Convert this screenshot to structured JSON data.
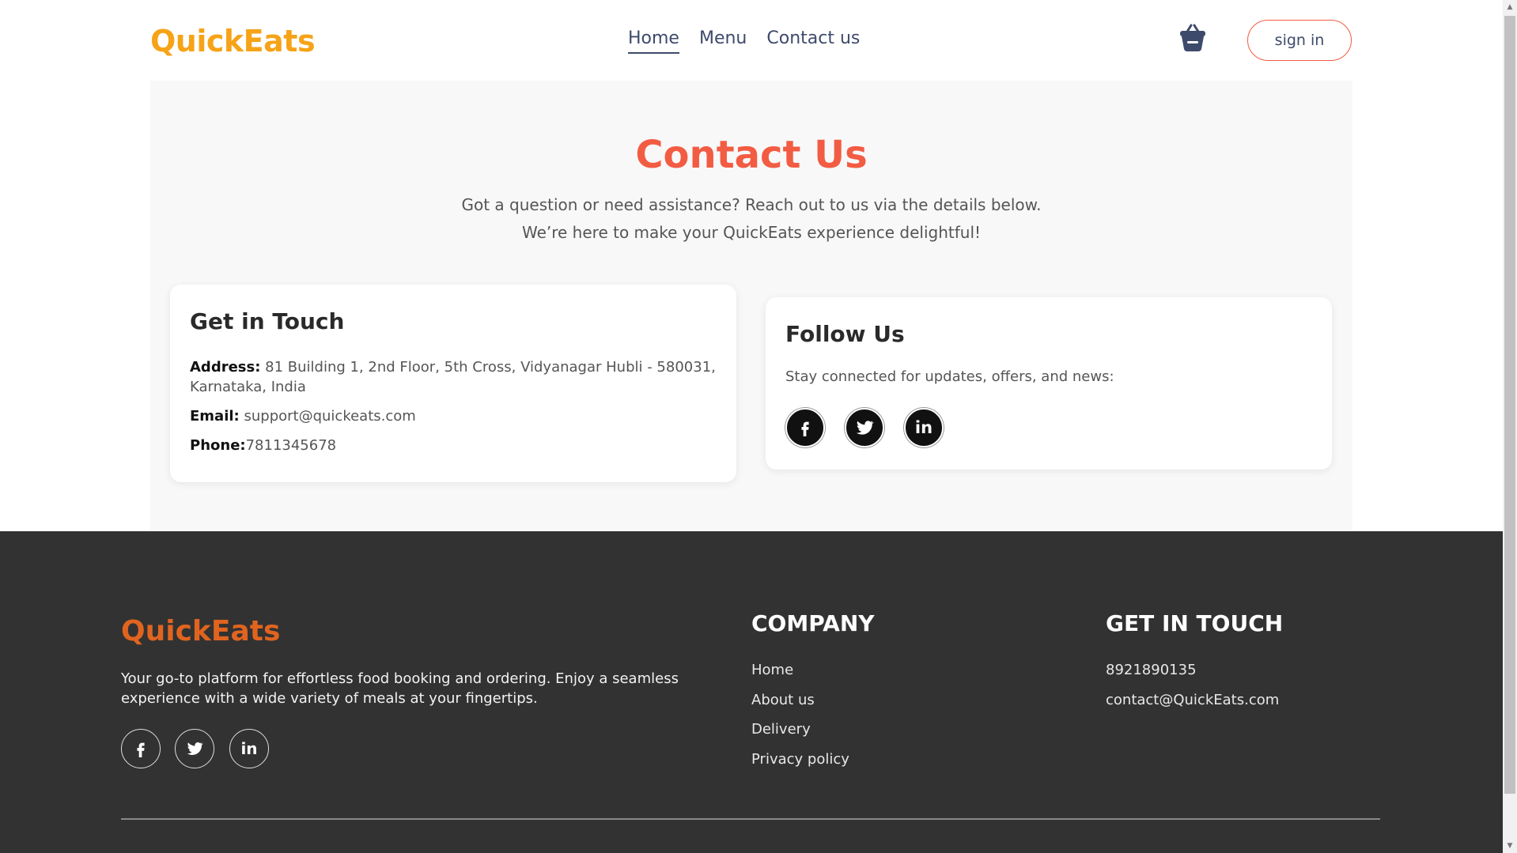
{
  "nav": {
    "logo": "QuickEats",
    "links": [
      {
        "label": "Home",
        "active": true
      },
      {
        "label": "Menu",
        "active": false
      },
      {
        "label": "Contact us",
        "active": false
      }
    ],
    "cart_icon": "basket-icon",
    "signin_label": "sign in"
  },
  "contact": {
    "title": "Contact Us",
    "subtitle_line1": "Got a question or need assistance? Reach out to us via the details below.",
    "subtitle_line2": "We’re here to make your QuickEats experience delightful!",
    "touch": {
      "heading": "Get in Touch",
      "address_label": "Address:",
      "address_value": "81 Building 1, 2nd Floor, 5th Cross, Vidyanagar Hubli - 580031, Karnataka, India",
      "email_label": "Email:",
      "email_value": "support@quickeats.com",
      "phone_label": "Phone:",
      "phone_value": "7811345678"
    },
    "follow": {
      "heading": "Follow Us",
      "text": "Stay connected for updates, offers, and news:",
      "icons": [
        "facebook-icon",
        "twitter-icon",
        "linkedin-icon"
      ]
    }
  },
  "footer": {
    "logo": "QuickEats",
    "description": "Your go-to platform for effortless food booking and ordering. Enjoy a seamless experience with a wide variety of meals at your fingertips.",
    "company_heading": "COMPANY",
    "company_links": [
      "Home",
      "About us",
      "Delivery",
      "Privacy policy"
    ],
    "touch_heading": "GET IN TOUCH",
    "phone": "8921890135",
    "email": "contact@QuickEats.com"
  },
  "colors": {
    "accent_orange": "#f6a317",
    "title_red": "#f25c43",
    "footer_logo": "#e0641f",
    "footer_bg": "#323232",
    "nav_text": "#3d4a6b"
  }
}
